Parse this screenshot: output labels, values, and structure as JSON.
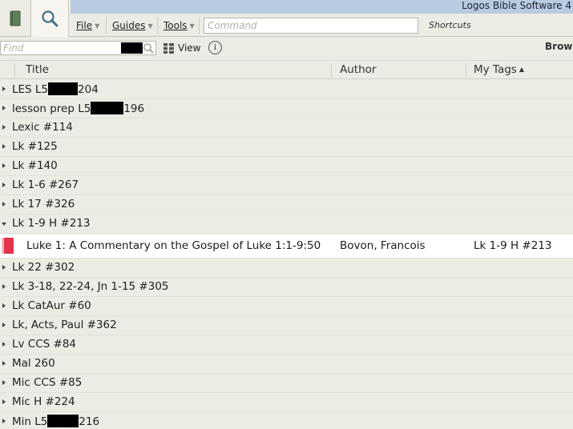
{
  "app_title": "Logos Bible Software 4",
  "toolbar": {
    "library_icon": "book-icon",
    "search_icon": "magnifier-icon",
    "menus": [
      {
        "label": "File"
      },
      {
        "label": "Guides"
      },
      {
        "label": "Tools"
      }
    ],
    "command_placeholder": "Command",
    "shortcuts_label": "Shortcuts"
  },
  "findbar": {
    "find_placeholder": "Find",
    "view_label": "View",
    "info_icon": "info-icon",
    "browse_label": "Brows"
  },
  "columns": {
    "title": "Title",
    "author": "Author",
    "tags": "My Tags"
  },
  "rows": [
    {
      "pre": "LES L5",
      "post": "204"
    },
    {
      "pre": "lesson prep L5",
      "post": "196"
    },
    {
      "pre": "Lexic #114"
    },
    {
      "pre": "Lk #125"
    },
    {
      "pre": "Lk #140"
    },
    {
      "pre": "Lk 1-6 #267"
    },
    {
      "pre": "Lk 17 #326"
    },
    {
      "pre": "Lk 1-9 H #213",
      "expanded": true
    }
  ],
  "expanded_item": {
    "title": "Luke 1: A Commentary on the Gospel of Luke 1:1-9:50",
    "author": "Bovon, Francois",
    "tags": "Lk 1-9 H #213"
  },
  "rows_after": [
    {
      "pre": "Lk 22 #302"
    },
    {
      "pre": "Lk 3-18, 22-24, Jn 1-15 #305"
    },
    {
      "pre": "Lk CatAur #60"
    },
    {
      "pre": "Lk, Acts, Paul #362"
    },
    {
      "pre": "Lv CCS #84"
    },
    {
      "pre": "Mal 260"
    },
    {
      "pre": "Mic CCS #85"
    },
    {
      "pre": "Mic H #224"
    },
    {
      "pre": "Min L5",
      "post": "216"
    }
  ]
}
